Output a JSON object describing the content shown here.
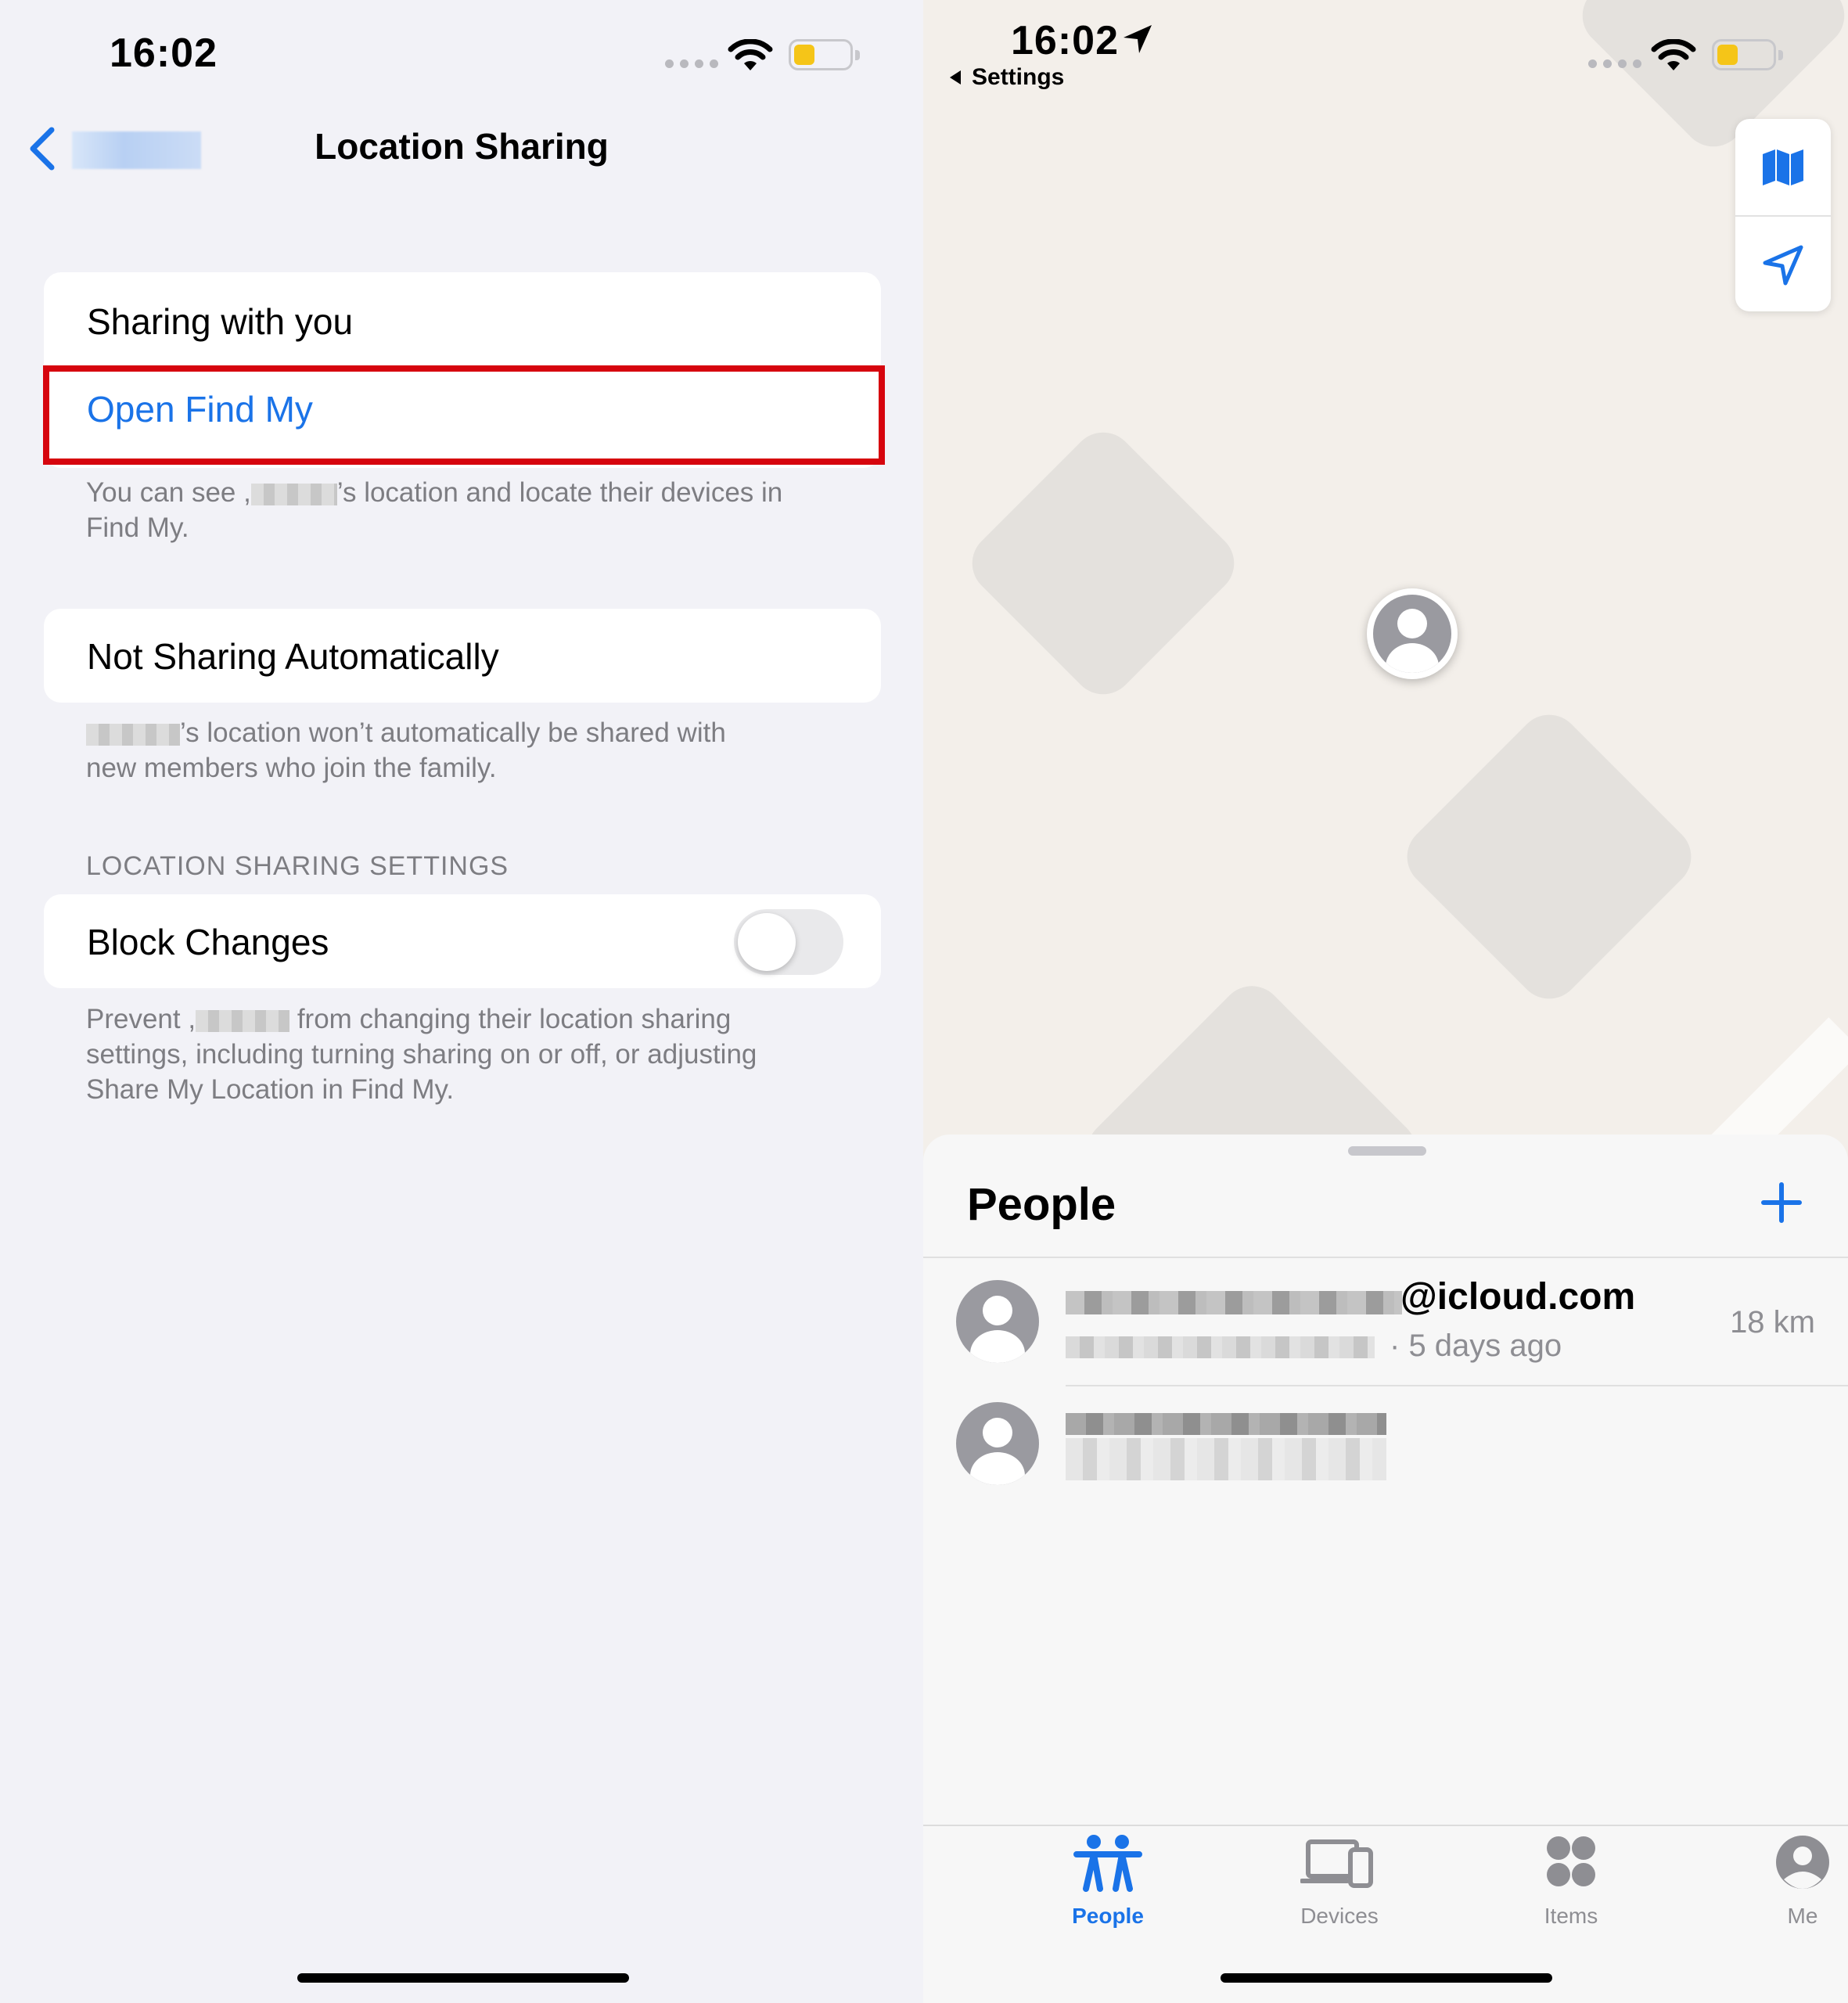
{
  "left": {
    "status": {
      "time": "16:02"
    },
    "nav": {
      "back_label": "",
      "title": "Location Sharing"
    },
    "sharing_card": {
      "row1": "Sharing with you",
      "row2": "Open Find My"
    },
    "footnote1_pre": "You can see ,",
    "footnote1_post": "’s location and locate their devices in",
    "footnote1_line2": "Find My.",
    "not_sharing_card": {
      "row": "Not Sharing Automatically"
    },
    "footnote2_post": "’s location won’t automatically be shared with",
    "footnote2_line2": "new members who join the family.",
    "section_header": "LOCATION SHARING SETTINGS",
    "block_card": {
      "label": "Block Changes",
      "toggle_on": false
    },
    "footnote3_pre": "Prevent ,",
    "footnote3_post": "from changing their location sharing",
    "footnote3_line2": "settings, including turning sharing on or off, or adjusting",
    "footnote3_line3": "Share My Location in Find My."
  },
  "right": {
    "status": {
      "time": "16:02",
      "back_app": "Settings"
    },
    "sheet": {
      "title": "People",
      "people": [
        {
          "name_suffix": "@icloud.com",
          "subtitle": "5 days ago",
          "distance": "18 km"
        },
        {
          "name_suffix": "",
          "subtitle": "",
          "distance": ""
        }
      ]
    },
    "tabs": [
      {
        "label": "People",
        "icon": "people-icon",
        "active": true
      },
      {
        "label": "Devices",
        "icon": "devices-icon",
        "active": false
      },
      {
        "label": "Items",
        "icon": "items-icon",
        "active": false
      },
      {
        "label": "Me",
        "icon": "me-icon",
        "active": false
      }
    ]
  },
  "colors": {
    "accent": "#1a73e8",
    "highlight_border": "#d6050e",
    "battery": "#f5c518",
    "background": "#f2f2f7"
  }
}
